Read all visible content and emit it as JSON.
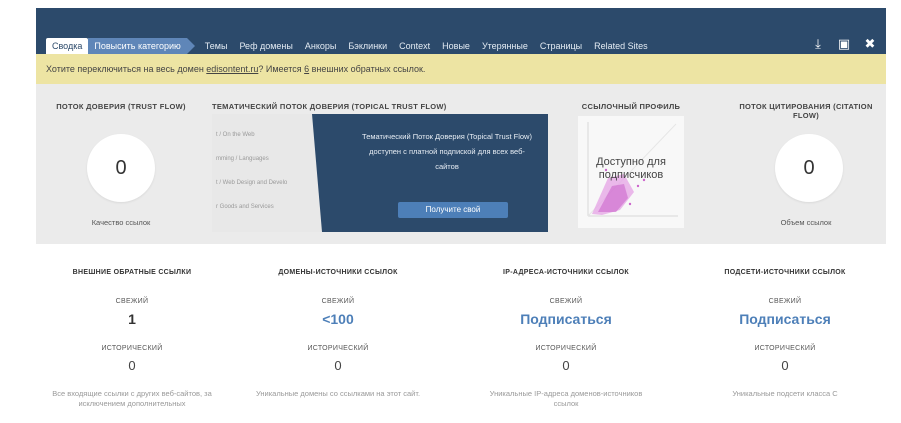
{
  "nav": {
    "tabs": [
      {
        "label": "Сводка"
      },
      {
        "label": "Повысить категорию"
      },
      {
        "label": "Темы"
      },
      {
        "label": "Реф домены"
      },
      {
        "label": "Анкоры"
      },
      {
        "label": "Бэклинки"
      },
      {
        "label": "Context"
      },
      {
        "label": "Новые"
      },
      {
        "label": "Утерянные"
      },
      {
        "label": "Страницы"
      },
      {
        "label": "Related Sites"
      }
    ],
    "tools": [
      {
        "icon": "download-icon",
        "glyph": "⤓"
      },
      {
        "icon": "export-icon",
        "glyph": "▣"
      },
      {
        "icon": "tools-icon",
        "glyph": "✖"
      }
    ]
  },
  "notice": {
    "before": "Хотите переключиться на весь домен ",
    "domain_link": "edisontent.ru",
    "middle": "? Имеется ",
    "count_link": "6",
    "after": " внешних обратных ссылок."
  },
  "metrics": {
    "trust_flow": {
      "title": "ПОТОК ДОВЕРИЯ (TRUST FLOW)",
      "value": "0",
      "sub": "Качество ссылок"
    },
    "topical": {
      "title": "ТЕМАТИЧЕСКИЙ ПОТОК ДОВЕРИЯ (TOPICAL TRUST FLOW)",
      "rows": [
        "t / On the Web",
        "mming / Languages",
        "t / Web Design and Develo",
        "r Goods and Services"
      ],
      "message": "Тематический Поток Доверия (Topical Trust Flow) доступен с платной подпиской для всех веб-сайтов",
      "button": "Получите свой"
    },
    "link_profile": {
      "title": "ССЫЛОЧНЫЙ ПРОФИЛЬ",
      "overlay": "Доступно для подписчиков"
    },
    "citation_flow": {
      "title": "ПОТОК ЦИТИРОВАНИЯ (CITATION FLOW)",
      "value": "0",
      "sub": "Объем ссылок"
    }
  },
  "stats": [
    {
      "title": "ВНЕШНИЕ ОБРАТНЫЕ ССЫЛКИ",
      "fresh_label": "СВЕЖИЙ",
      "fresh": "1",
      "hist_label": "ИСТОРИЧЕСКИЙ",
      "hist": "0",
      "desc": "Все входящие ссылки с других веб-сайтов, за исключением дополнительных"
    },
    {
      "title": "ДОМЕНЫ-ИСТОЧНИКИ ССЫЛОК",
      "fresh_label": "СВЕЖИЙ",
      "fresh": "<100",
      "hist_label": "ИСТОРИЧЕСКИЙ",
      "hist": "0",
      "desc": "Уникальные домены со ссылками на этот сайт."
    },
    {
      "title": "IP-АДРЕСА-ИСТОЧНИКИ ССЫЛОК",
      "fresh_label": "СВЕЖИЙ",
      "fresh": "Подписаться",
      "hist_label": "ИСТОРИЧЕСКИЙ",
      "hist": "0",
      "desc": "Уникальные IP-адреса доменов-источников ссылок"
    },
    {
      "title": "ПОДСЕТИ-ИСТОЧНИКИ ССЫЛОК",
      "fresh_label": "СВЕЖИЙ",
      "fresh": "Подписаться",
      "hist_label": "ИСТОРИЧЕСКИЙ",
      "hist": "0",
      "desc": "Уникальные подсети класса C"
    }
  ],
  "colors": {
    "nav": "#2c4a6b",
    "accent": "#4d7fb8",
    "notice": "#ede4a3",
    "panel": "#ebebeb",
    "scatter": "#d26fd2"
  }
}
